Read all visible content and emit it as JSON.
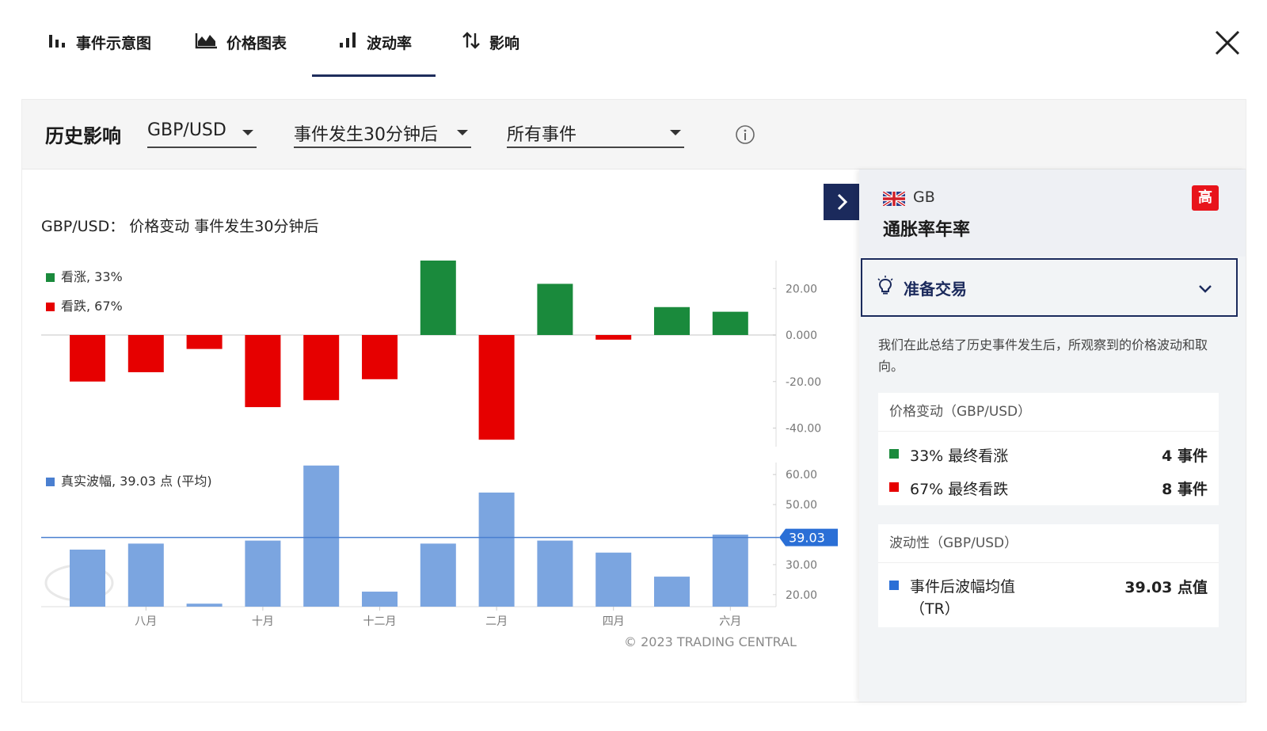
{
  "tabs": [
    {
      "label": "事件示意图",
      "icon": "bar-chart-icon"
    },
    {
      "label": "价格图表",
      "icon": "area-chart-icon"
    },
    {
      "label": "波动率",
      "icon": "bar-chart-icon",
      "active": true
    },
    {
      "label": "影响",
      "icon": "up-down-arrows-icon"
    }
  ],
  "filterbar": {
    "title": "历史影响",
    "pair": "GBP/USD",
    "timeframe": "事件发生30分钟后",
    "events": "所有事件"
  },
  "chart_header": {
    "prefix": "GBP/USD：",
    "title": "价格变动 事件发生30分钟后"
  },
  "colors": {
    "bullish": "#1a8a3c",
    "bearish": "#e60000",
    "volatility": "#7ba5e0",
    "avg_line": "#4a7fd0",
    "navy": "#1b2a5c",
    "badge": "#e8141b"
  },
  "chart_data": [
    {
      "type": "bar",
      "series": [
        {
          "name": "价格变动",
          "values": [
            -20,
            -16,
            -6,
            -31,
            -28,
            -19,
            32,
            -45,
            22,
            -2,
            12,
            10
          ]
        }
      ],
      "legend": [
        "看涨, 33%",
        "看跌, 67%"
      ],
      "yticks": [
        "20.00",
        "0.000",
        "-20.00",
        "-40.00"
      ],
      "ylim": [
        -48,
        32
      ]
    },
    {
      "type": "bar",
      "series": [
        {
          "name": "真实波幅",
          "values": [
            35,
            37,
            17,
            38,
            63,
            21,
            37,
            54,
            38,
            34,
            26,
            40
          ]
        }
      ],
      "legend": [
        "真实波幅, 39.03 点 (平均)"
      ],
      "yticks": [
        "60.00",
        "50.00",
        "30.00",
        "20.00"
      ],
      "avg_label": "39.03",
      "avg": 39.03,
      "ylim": [
        16,
        64
      ],
      "xticks": [
        "八月",
        "十月",
        "十二月",
        "二月",
        "四月",
        "六月"
      ]
    }
  ],
  "copyright": "© 2023 TRADING CENTRAL",
  "side": {
    "country": "GB",
    "impact": "高",
    "event": "通胀率年率",
    "accordion_label": "准备交易",
    "description": "我们在此总结了历史事件发生后，所观察到的价格波动和取向。",
    "price_card": {
      "title": "价格变动（GBP/USD）",
      "rows": [
        {
          "label": "33% 最终看涨",
          "value": "4 事件"
        },
        {
          "label": "67% 最终看跌",
          "value": "8 事件"
        }
      ]
    },
    "vol_card": {
      "title": "波动性（GBP/USD）",
      "label_line1": "事件后波幅均值",
      "label_line2": "（TR）",
      "value": "39.03 点值"
    }
  }
}
